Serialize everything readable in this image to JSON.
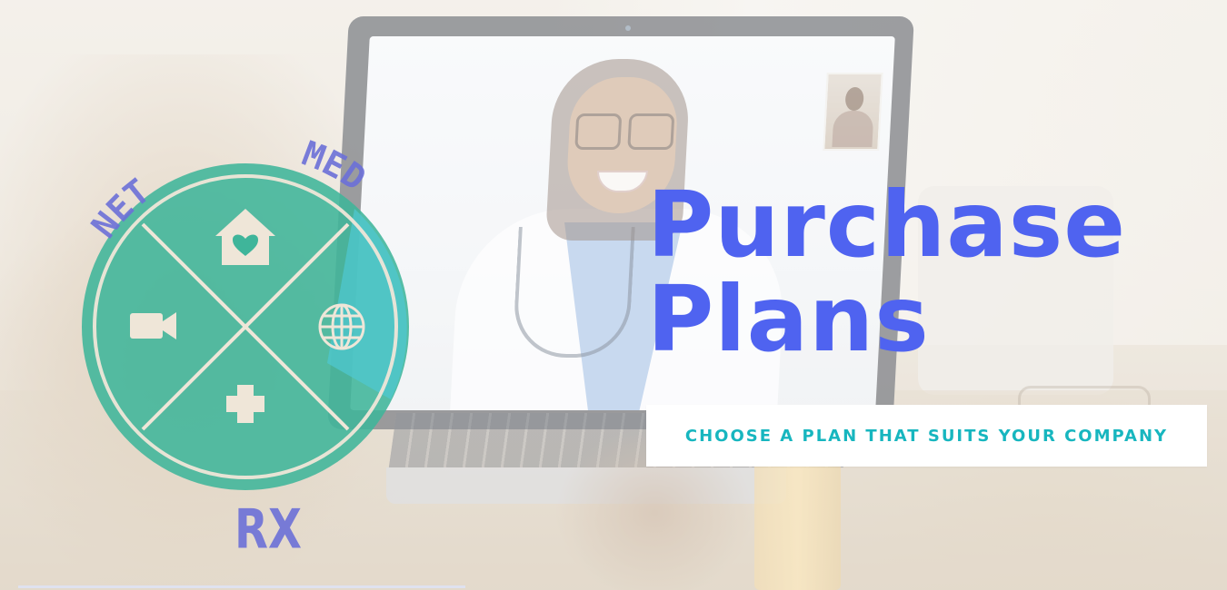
{
  "hero": {
    "title_line1": "Purchase",
    "title_line2": "Plans",
    "subtitle": "CHOOSE A PLAN THAT SUITS YOUR COMPANY"
  },
  "logo": {
    "word_left": "NET",
    "word_right": "MED",
    "word_bottom": "RX",
    "icons": [
      "home-heart-icon",
      "video-camera-icon",
      "globe-icon",
      "plus-icon"
    ]
  },
  "colors": {
    "title": "#4f63f0",
    "subtitle": "#17b6bf",
    "logo_circle": "#3fb59a",
    "logo_accent": "#4ec9d3",
    "logo_text": "#6c70d8"
  }
}
